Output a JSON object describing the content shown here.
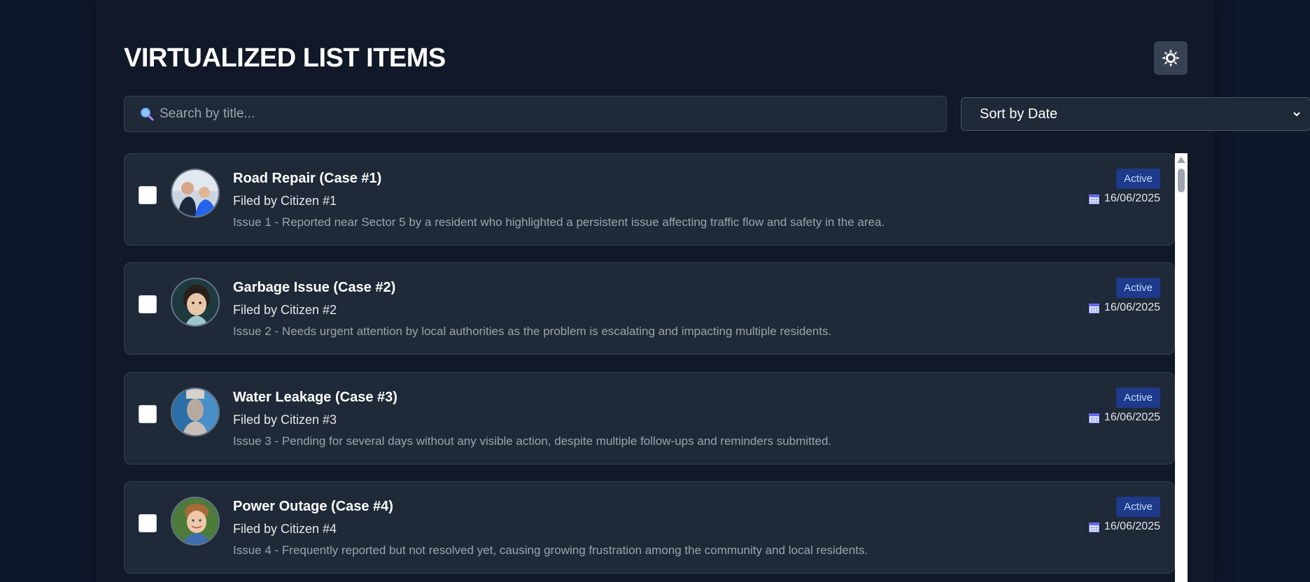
{
  "header": {
    "title": "VIRTUALIZED LIST ITEMS",
    "theme_toggle_icon": "sun-icon"
  },
  "search": {
    "placeholder": "Search by title...",
    "value": "",
    "icon": "magnifier-icon"
  },
  "sort": {
    "selected": "Sort by Date",
    "icon": "chevron-down-icon"
  },
  "colors": {
    "page_bg": "#0f172a",
    "card_bg": "#1f2937",
    "badge_bg": "#1e3a8a",
    "badge_text": "#bfdbfe"
  },
  "items": [
    {
      "title": "Road Repair (Case #1)",
      "filed_by": "Filed by Citizen #1",
      "description": "Issue 1 - Reported near Sector 5 by a resident who highlighted a persistent issue affecting traffic flow and safety in the area.",
      "status": "Active",
      "date": "16/06/2025",
      "checked": false,
      "avatar_icon": "photo-avatar-1"
    },
    {
      "title": "Garbage Issue (Case #2)",
      "filed_by": "Filed by Citizen #2",
      "description": "Issue 2 - Needs urgent attention by local authorities as the problem is escalating and impacting multiple residents.",
      "status": "Active",
      "date": "16/06/2025",
      "checked": false,
      "avatar_icon": "photo-avatar-2"
    },
    {
      "title": "Water Leakage (Case #3)",
      "filed_by": "Filed by Citizen #3",
      "description": "Issue 3 - Pending for several days without any visible action, despite multiple follow-ups and reminders submitted.",
      "status": "Active",
      "date": "16/06/2025",
      "checked": false,
      "avatar_icon": "photo-avatar-3"
    },
    {
      "title": "Power Outage (Case #4)",
      "filed_by": "Filed by Citizen #4",
      "description": "Issue 4 - Frequently reported but not resolved yet, causing growing frustration among the community and local residents.",
      "status": "Active",
      "date": "16/06/2025",
      "checked": false,
      "avatar_icon": "photo-avatar-4"
    }
  ]
}
